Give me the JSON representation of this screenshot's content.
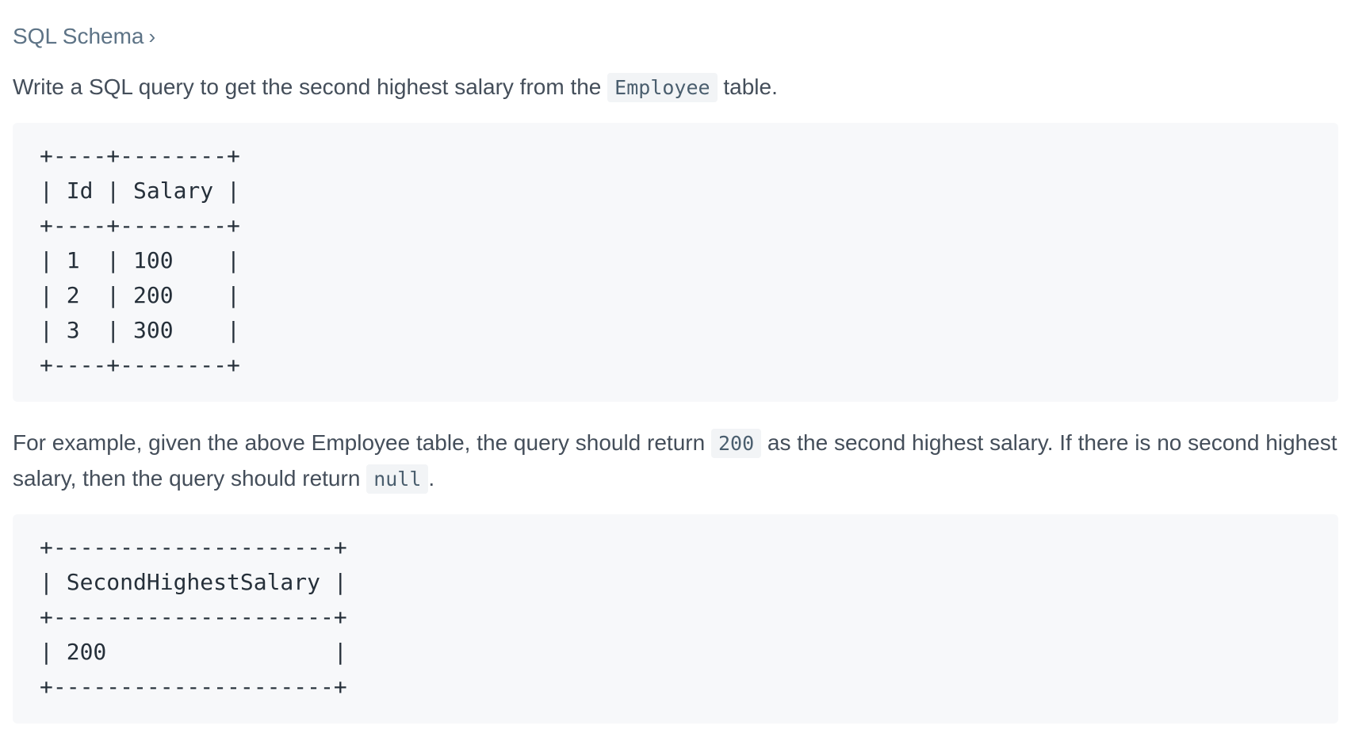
{
  "header": {
    "schema_link_label": "SQL Schema",
    "chevron_glyph": "›"
  },
  "description": {
    "intro_before": "Write a SQL query to get the second highest salary from the ",
    "intro_code": "Employee",
    "intro_after": " table.",
    "example_before": "For example, given the above Employee table, the query should return ",
    "example_code_value": "200",
    "example_middle": " as the second highest salary. If there is no second highest salary, then the query should return ",
    "example_code_null": "null",
    "example_after": "."
  },
  "input_table": {
    "lines": [
      "+----+--------+",
      "| Id | Salary |",
      "+----+--------+",
      "| 1  | 100    |",
      "| 2  | 200    |",
      "| 3  | 300    |",
      "+----+--------+"
    ]
  },
  "output_table": {
    "lines": [
      "+---------------------+",
      "| SecondHighestSalary |",
      "+---------------------+",
      "| 200                 |",
      "+---------------------+"
    ]
  }
}
